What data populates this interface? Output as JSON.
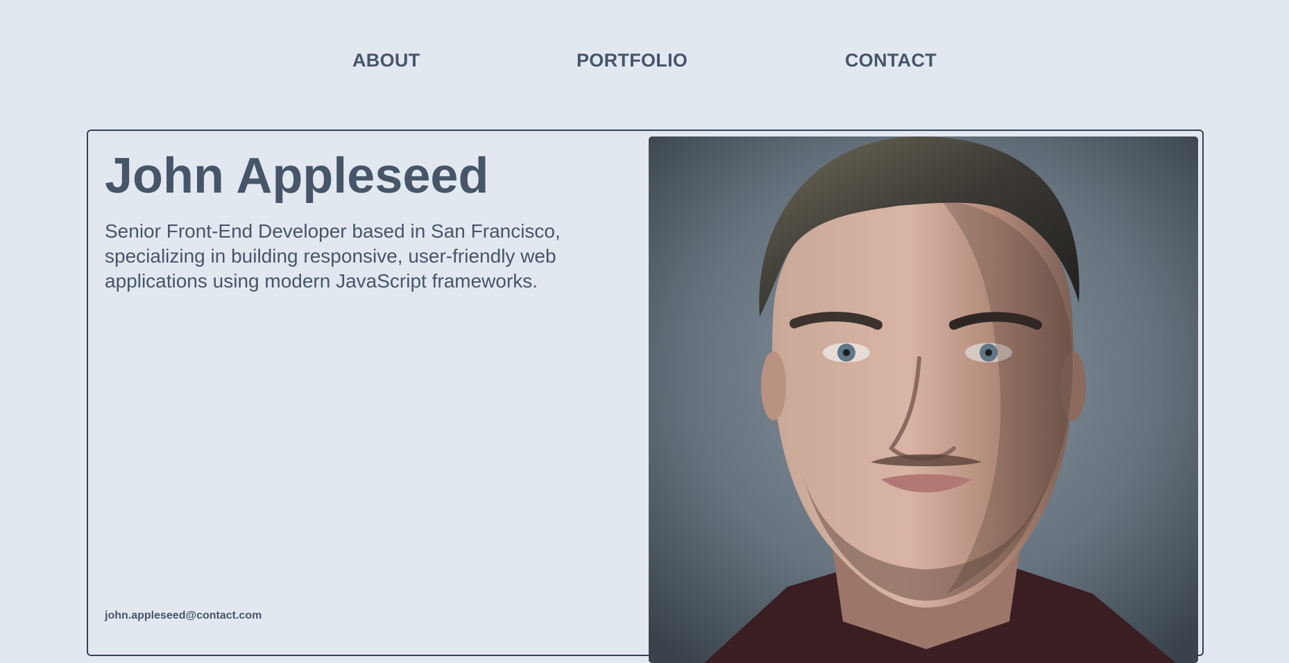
{
  "nav": {
    "items": [
      {
        "label": "ABOUT"
      },
      {
        "label": "PORTFOLIO"
      },
      {
        "label": "CONTACT"
      }
    ]
  },
  "profile": {
    "name": "John Appleseed",
    "bio": "Senior Front-End Developer based in San Francisco, specializing in building responsive, user-friendly web applications using modern JavaScript frameworks.",
    "email": "john.appleseed@contact.com"
  },
  "colors": {
    "background": "#e2e8f0",
    "text": "#475569",
    "border": "#334155"
  }
}
